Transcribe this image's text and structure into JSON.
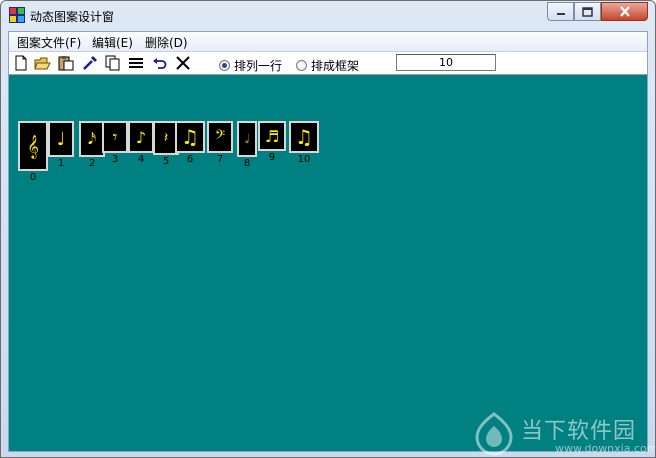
{
  "window": {
    "title": "动态图案设计窗"
  },
  "menu": [
    {
      "label": "图案文件(F)"
    },
    {
      "label": "编辑(E)"
    },
    {
      "label": "删除(D)"
    }
  ],
  "toolbar": {
    "icons": [
      "new-file-icon",
      "open-folder-icon",
      "paste-icon",
      "eyedropper-icon",
      "copy-icon",
      "list-icon",
      "undo-icon",
      "delete-x-icon"
    ],
    "radio1": {
      "label": "排列一行",
      "checked": true
    },
    "radio2": {
      "label": "排成框架",
      "checked": false
    },
    "number_value": "10"
  },
  "symbols": [
    {
      "glyph": "𝄞",
      "label": "0"
    },
    {
      "glyph": "♩",
      "label": "1"
    },
    {
      "glyph": "𝅘𝅥𝅯",
      "label": "2"
    },
    {
      "glyph": "𝄾",
      "label": "3"
    },
    {
      "glyph": "♪",
      "label": "4"
    },
    {
      "glyph": "𝄽",
      "label": "5"
    },
    {
      "glyph": "♫",
      "label": "6"
    },
    {
      "glyph": "𝄢",
      "label": "7"
    },
    {
      "glyph": "𝅗𝅥",
      "label": "8"
    },
    {
      "glyph": "♬",
      "label": "9"
    },
    {
      "glyph": "♫",
      "label": "10"
    }
  ],
  "watermark": {
    "text": "当下软件园",
    "url": "www.downxia.com"
  },
  "colors": {
    "canvas": "#008080",
    "symbol": "#ffea00"
  }
}
